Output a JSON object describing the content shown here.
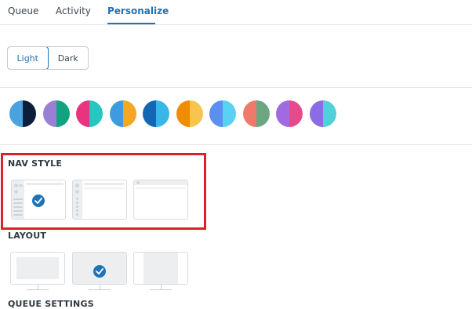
{
  "tabs": [
    {
      "label": "Queue"
    },
    {
      "label": "Activity"
    },
    {
      "label": "Personalize"
    }
  ],
  "theme": {
    "light_label": "Light",
    "dark_label": "Dark",
    "selected": "Light"
  },
  "color_swatches": [
    {
      "name": "blue-navy",
      "left": "#4aa3df",
      "right": "#0b1f3a"
    },
    {
      "name": "purple-green",
      "left": "#9b7fd4",
      "right": "#11a37f"
    },
    {
      "name": "pink-teal",
      "left": "#e8337e",
      "right": "#26c6c1"
    },
    {
      "name": "blue-orange",
      "left": "#3d9ce0",
      "right": "#f5a623"
    },
    {
      "name": "darkblue-skyblue",
      "left": "#1266b3",
      "right": "#38b6e8"
    },
    {
      "name": "orange-yellow",
      "left": "#f08c00",
      "right": "#f7c44e"
    },
    {
      "name": "blue-cyan",
      "left": "#5b8ff0",
      "right": "#58d1f2"
    },
    {
      "name": "salmon-green",
      "left": "#f07a6a",
      "right": "#6aa67f"
    },
    {
      "name": "purple-magenta",
      "left": "#a26ae0",
      "right": "#e64a8c"
    },
    {
      "name": "violet-teal",
      "left": "#8b6be6",
      "right": "#52d0d8"
    }
  ],
  "nav_style": {
    "title": "NAV STYLE",
    "selected_index": 0
  },
  "layout": {
    "title": "LAYOUT",
    "selected_index": 1
  },
  "queue_settings": {
    "title": "QUEUE SETTINGS"
  },
  "colors": {
    "accent": "#1f73b7",
    "highlight": "#d9232a"
  }
}
